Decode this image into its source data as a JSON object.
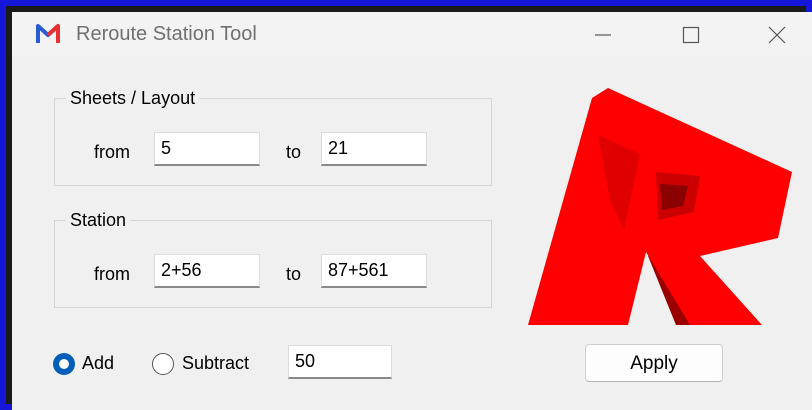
{
  "window": {
    "title": "Reroute Station Tool",
    "app_icon": "m-logo-icon",
    "controls": [
      "minimize-icon",
      "maximize-icon",
      "close-icon"
    ]
  },
  "sheets": {
    "group_label": "Sheets / Layout",
    "from_label": "from",
    "from_value": "5",
    "to_label": "to",
    "to_value": "21"
  },
  "station": {
    "group_label": "Station",
    "from_label": "from",
    "from_value": "2+56",
    "to_label": "to",
    "to_value": "87+561"
  },
  "mode": {
    "add_label": "Add",
    "subtract_label": "Subtract",
    "selected": "Add",
    "amount_value": "50"
  },
  "apply_label": "Apply",
  "logo_letter": "R",
  "colors": {
    "logo_red": "#ff0000",
    "logo_shadow": "#8a0000",
    "radio_accent": "#005fb8",
    "frame_blue": "#1616d8"
  }
}
